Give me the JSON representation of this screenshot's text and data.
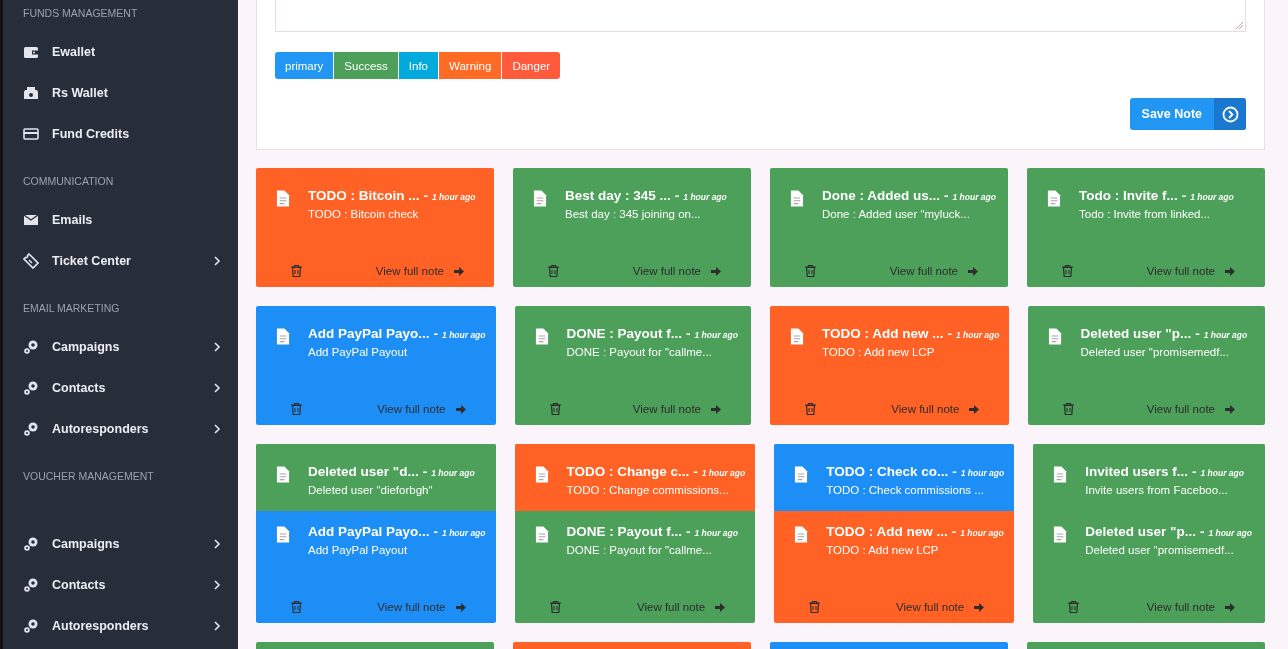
{
  "sidebar": {
    "sections": [
      {
        "heading": "FUNDS MANAGEMENT",
        "items": [
          {
            "label": "Ewallet",
            "expandable": false
          },
          {
            "label": "Rs Wallet",
            "expandable": false
          },
          {
            "label": "Fund Credits",
            "expandable": false
          }
        ]
      },
      {
        "heading": "COMMUNICATION",
        "items": [
          {
            "label": "Emails",
            "expandable": false
          },
          {
            "label": "Ticket Center",
            "expandable": true
          }
        ]
      },
      {
        "heading": "EMAIL MARKETING",
        "items": [
          {
            "label": "Campaigns",
            "expandable": true
          },
          {
            "label": "Contacts",
            "expandable": true
          },
          {
            "label": "Autoresponders",
            "expandable": true
          }
        ]
      },
      {
        "heading": "VOUCHER MANAGEMENT"
      },
      {
        "items": [
          {
            "label": "Campaigns",
            "expandable": true
          },
          {
            "label": "Contacts",
            "expandable": true
          },
          {
            "label": "Autoresponders",
            "expandable": true
          }
        ]
      }
    ]
  },
  "note_form": {
    "color_buttons": [
      {
        "label": "primary",
        "color": "#2196f3"
      },
      {
        "label": "Success",
        "color": "#4ca05a"
      },
      {
        "label": "Info",
        "color": "#00aadd"
      },
      {
        "label": "Warning",
        "color": "#ff6b24"
      },
      {
        "label": "Danger",
        "color": "#ff5a3c"
      }
    ],
    "save_button": "Save Note"
  },
  "note_rows": [
    {
      "cards": [
        {
          "color": "#ff6224",
          "title": "TODO : Bitcoin ...",
          "separator": "-",
          "time": "1 hour ago",
          "preview": "TODO : Bitcoin check",
          "link": "View full note"
        },
        {
          "color": "#4ca05a",
          "title": "Best day : 345 ...",
          "separator": "-",
          "time": "1 hour ago",
          "preview": "Best day : 345 joining on...",
          "link": "View full note"
        },
        {
          "color": "#4ca05a",
          "title": "Done : Added us...",
          "separator": "-",
          "time": "1 hour ago",
          "preview": "Done : Added user \"myluck...",
          "link": "View full note"
        },
        {
          "color": "#4ca05a",
          "title": "Todo : Invite f...",
          "separator": "-",
          "time": "1 hour ago",
          "preview": "Todo : Invite from linked...",
          "link": "View full note"
        }
      ]
    },
    {
      "cards": [
        {
          "color": "#1e8ef7",
          "title": "Add PayPal Payo...",
          "separator": "-",
          "time": "1 hour ago",
          "preview": "Add PayPal Payout",
          "link": "View full note"
        },
        {
          "color": "#4ca05a",
          "title": "DONE : Payout f...",
          "separator": "-",
          "time": "1 hour ago",
          "preview": "DONE : Payout for \"callme...",
          "link": "View full note"
        },
        {
          "color": "#ff6224",
          "title": "TODO : Add new ...",
          "separator": "-",
          "time": "1 hour ago",
          "preview": "TODO : Add new LCP",
          "link": "View full note"
        },
        {
          "color": "#4ca05a",
          "title": "Deleted user \"p...",
          "separator": "-",
          "time": "1 hour ago",
          "preview": "Deleted user \"promisemedf...",
          "link": "View full note"
        }
      ]
    },
    {
      "cards": [
        {
          "color": "#1e8ef7",
          "title": "Add PayPal Payo...",
          "separator": "-",
          "time": "1 hour ago",
          "preview": "Add PayPal Payout",
          "link": "View full note",
          "behind": {
            "color": "#4ca05a",
            "title": "Deleted user \"d...",
            "separator": "-",
            "time": "1 hour ago",
            "preview": "Deleted user \"dieforbgh\""
          }
        },
        {
          "color": "#4ca05a",
          "title": "DONE : Payout f...",
          "separator": "-",
          "time": "1 hour ago",
          "preview": "DONE : Payout for \"callme...",
          "link": "View full note",
          "behind": {
            "color": "#ff6224",
            "title": "TODO : Change c...",
            "separator": "-",
            "time": "1 hour ago",
            "preview": "TODO : Change commissions..."
          }
        },
        {
          "color": "#ff6224",
          "title": "TODO : Add new ...",
          "separator": "-",
          "time": "1 hour ago",
          "preview": "TODO : Add new LCP",
          "link": "View full note",
          "behind": {
            "color": "#1e8ef7",
            "title": "TODO : Check co...",
            "separator": "-",
            "time": "1 hour ago",
            "preview": "TODO : Check commissions ..."
          }
        },
        {
          "color": "#4ca05a",
          "title": "Deleted user \"p...",
          "separator": "-",
          "time": "1 hour ago",
          "preview": "Deleted user \"promisemedf...",
          "link": "View full note",
          "behind": {
            "color": "#4ca05a",
            "title": "Invited users f...",
            "separator": "-",
            "time": "1 hour ago",
            "preview": "Invite users from Faceboo..."
          }
        }
      ]
    },
    {
      "cards": [
        {
          "color": "#4ca05a"
        },
        {
          "color": "#ff6224"
        },
        {
          "color": "#1e8ef7"
        },
        {
          "color": "#4ca05a"
        }
      ]
    }
  ]
}
